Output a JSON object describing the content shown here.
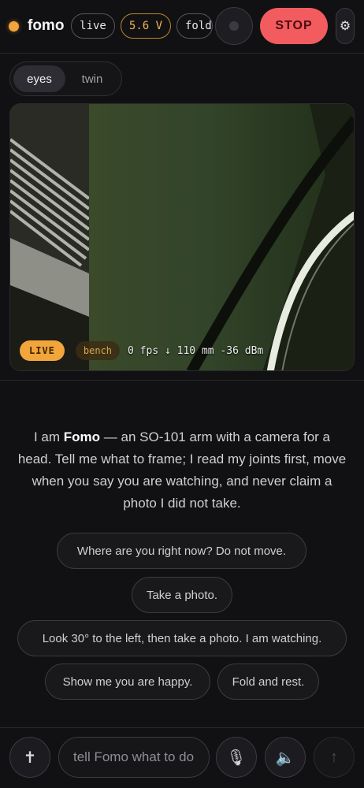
{
  "header": {
    "brand": "fomo",
    "status_pill": "live",
    "voltage_pill": "5.6 V",
    "fold_pill": "fold",
    "stop_label": "STOP",
    "settings_icon": "⚙"
  },
  "tabs": [
    {
      "label": "eyes",
      "active": true
    },
    {
      "label": "twin",
      "active": false
    }
  ],
  "camera": {
    "live_badge": "LIVE",
    "scene_badge": "bench",
    "stats": "0 fps ↓ 110 mm -36 dBm"
  },
  "intro": {
    "prefix": "I am ",
    "name": "Fomo",
    "suffix": " — an SO-101 arm with a camera for a head. Tell me what to frame; I read my joints first, move when you say you are watching, and never claim a photo I did not take."
  },
  "suggestions": [
    "Where are you right now? Do not move.",
    "Take a photo.",
    "Look 30° to the left, then take a photo. I am watching.",
    "Show me you are happy.",
    "Fold and rest."
  ],
  "composer": {
    "placeholder": "tell Fomo what to do",
    "cross_icon": "✝",
    "mic_icon": "🎙",
    "speaker_icon": "🔈",
    "send_icon": "↑"
  },
  "colors": {
    "accent": "#f2a53a",
    "stop": "#f25c5f",
    "background": "#111113"
  }
}
